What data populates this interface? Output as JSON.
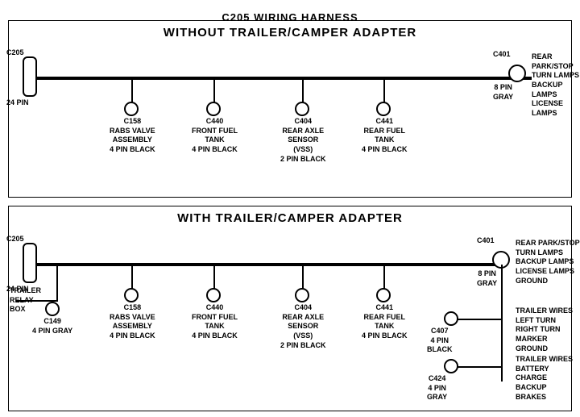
{
  "title": "C205 WIRING HARNESS",
  "section1": {
    "title": "WITHOUT  TRAILER/CAMPER ADAPTER",
    "connectors": {
      "c205": {
        "label": "C205",
        "pin": "24 PIN"
      },
      "c401": {
        "label": "C401",
        "pin": "8 PIN\nGRAY",
        "desc": "REAR PARK/STOP\nTURN LAMPS\nBACKUP LAMPS\nLICENSE LAMPS"
      },
      "c158": {
        "label": "C158",
        "desc": "RABS VALVE\nASSEMBLY\n4 PIN BLACK"
      },
      "c440": {
        "label": "C440",
        "desc": "FRONT FUEL\nTANK\n4 PIN BLACK"
      },
      "c404": {
        "label": "C404",
        "desc": "REAR AXLE\nSENSOR\n(VSS)\n2 PIN BLACK"
      },
      "c441": {
        "label": "C441",
        "desc": "REAR FUEL\nTANK\n4 PIN BLACK"
      }
    }
  },
  "section2": {
    "title": "WITH TRAILER/CAMPER ADAPTER",
    "connectors": {
      "c205": {
        "label": "C205",
        "pin": "24 PIN"
      },
      "c401": {
        "label": "C401",
        "pin": "8 PIN\nGRAY",
        "desc": "REAR PARK/STOP\nTURN LAMPS\nBACKUP LAMPS\nLICENSE LAMPS\nGROUND"
      },
      "c158": {
        "label": "C158",
        "desc": "RABS VALVE\nASSEMBLY\n4 PIN BLACK"
      },
      "c440": {
        "label": "C440",
        "desc": "FRONT FUEL\nTANK\n4 PIN BLACK"
      },
      "c404": {
        "label": "C404",
        "desc": "REAR AXLE\nSENSOR\n(VSS)\n2 PIN BLACK"
      },
      "c441": {
        "label": "C441",
        "desc": "REAR FUEL\nTANK\n4 PIN BLACK"
      },
      "c149": {
        "label": "C149",
        "desc": "4 PIN GRAY"
      },
      "trailer_relay": {
        "label": "TRAILER\nRELAY\nBOX"
      },
      "c407": {
        "label": "C407",
        "pin": "4 PIN\nBLACK",
        "desc": "TRAILER WIRES\nLEFT TURN\nRIGHT TURN\nMARKER\nGROUND"
      },
      "c424": {
        "label": "C424",
        "pin": "4 PIN\nGRAY",
        "desc": "TRAILER WIRES\nBATTERY CHARGE\nBACKUP\nBRAKES"
      }
    }
  }
}
